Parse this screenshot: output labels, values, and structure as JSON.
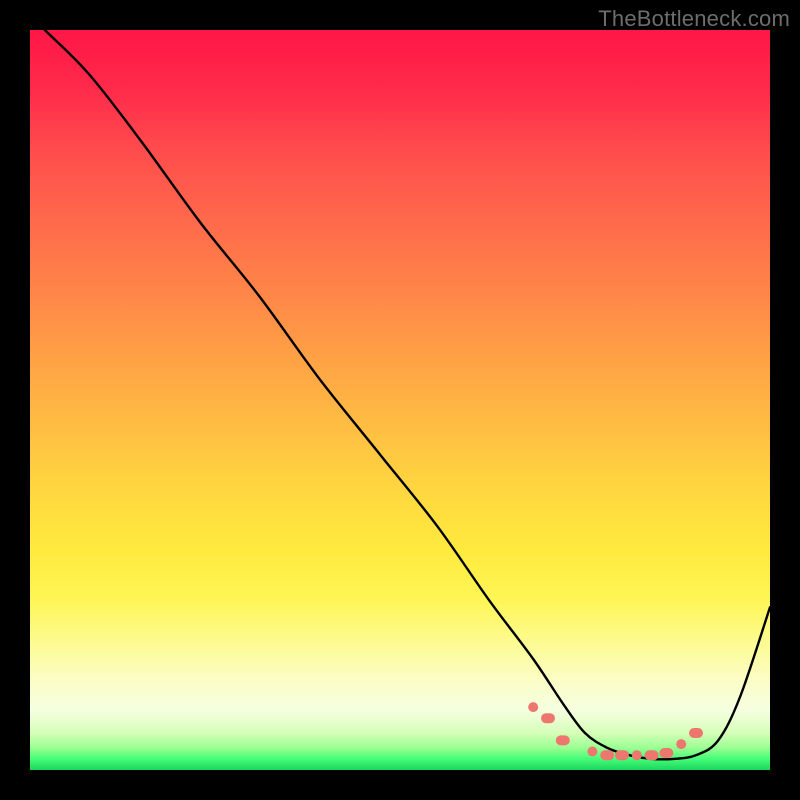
{
  "watermark": "TheBottleneck.com",
  "colors": {
    "frame": "#000000",
    "gradient_top": "#ff1746",
    "gradient_mid": "#ffd93f",
    "gradient_bottom": "#1bd65f",
    "curve": "#000000",
    "marker": "#ed766e",
    "watermark_text": "#6d6d6d"
  },
  "chart_data": {
    "type": "line",
    "title": "",
    "xlabel": "",
    "ylabel": "",
    "xlim": [
      0,
      100
    ],
    "ylim": [
      0,
      100
    ],
    "grid": false,
    "legend": false,
    "series": [
      {
        "name": "bottleneck-curve",
        "x": [
          2,
          8,
          15,
          23,
          31,
          39,
          47,
          55,
          62,
          68,
          72,
          75,
          78,
          81,
          84,
          87,
          90,
          93,
          96,
          100
        ],
        "values": [
          100,
          94,
          85,
          74,
          64,
          53,
          43,
          33,
          23,
          15,
          9,
          5,
          3,
          2,
          1.5,
          1.5,
          2,
          4,
          10,
          22
        ]
      }
    ],
    "markers": {
      "name": "highlight-dots",
      "x": [
        68,
        70,
        72,
        76,
        78,
        80,
        82,
        84,
        86,
        88,
        90
      ],
      "values": [
        8.5,
        7,
        4,
        2.5,
        2,
        2,
        2,
        2,
        2.3,
        3.5,
        5
      ]
    }
  }
}
